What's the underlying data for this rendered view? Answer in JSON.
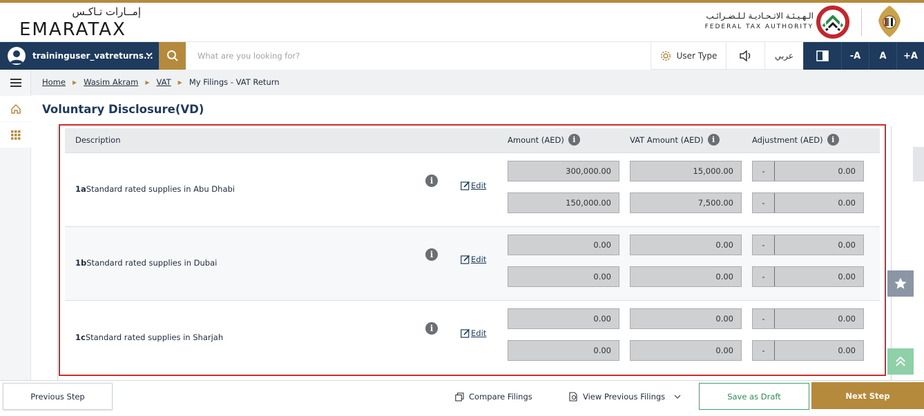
{
  "header": {
    "logo_ar": "إمــارات تـاكـس",
    "logo_en": "EMARATAX",
    "fta_ar": "الـهـيـئـة الاتـحـاديـة لـلـضـرائـب",
    "fta_en": "FEDERAL TAX AUTHORITY"
  },
  "navbar": {
    "user_name": "traininguser_vatreturns...",
    "search_placeholder": "What are you looking for?",
    "user_type": "User Type",
    "arabic": "عربي",
    "font_decrease": "-A",
    "font_normal": "A",
    "font_increase": "+A"
  },
  "breadcrumb": {
    "home": "Home",
    "user": "Wasim Akram",
    "vat": "VAT",
    "current": "My Filings - VAT Return"
  },
  "page_title": "Voluntary Disclosure(VD)",
  "table": {
    "headers": {
      "description": "Description",
      "amount": "Amount (AED)",
      "vat_amount": "VAT Amount (AED)",
      "adjustment": "Adjustment (AED)"
    },
    "info_glyph": "i",
    "edit_label": "Edit",
    "rows": [
      {
        "code": "1a",
        "label": "Standard rated supplies in Abu Dhabi",
        "amount": [
          "300,000.00",
          "150,000.00"
        ],
        "vat": [
          "15,000.00",
          "7,500.00"
        ],
        "adj_sign": [
          "-",
          "-"
        ],
        "adj": [
          "0.00",
          "0.00"
        ]
      },
      {
        "code": "1b",
        "label": "Standard rated supplies in Dubai",
        "amount": [
          "0.00",
          "0.00"
        ],
        "vat": [
          "0.00",
          "0.00"
        ],
        "adj_sign": [
          "-",
          "-"
        ],
        "adj": [
          "0.00",
          "0.00"
        ]
      },
      {
        "code": "1c",
        "label": "Standard rated supplies in Sharjah",
        "amount": [
          "0.00",
          "0.00"
        ],
        "vat": [
          "0.00",
          "0.00"
        ],
        "adj_sign": [
          "-",
          "-"
        ],
        "adj": [
          "0.00",
          "0.00"
        ]
      }
    ]
  },
  "footer": {
    "previous": "Previous Step",
    "compare": "Compare Filings",
    "view_previous": "View Previous Filings",
    "save_draft": "Save as Draft",
    "next": "Next Step"
  },
  "colors": {
    "navy": "#1e3a5c",
    "gold": "#b58a3c",
    "highlight": "#d02a2a",
    "draft_green": "#2d8a57"
  }
}
